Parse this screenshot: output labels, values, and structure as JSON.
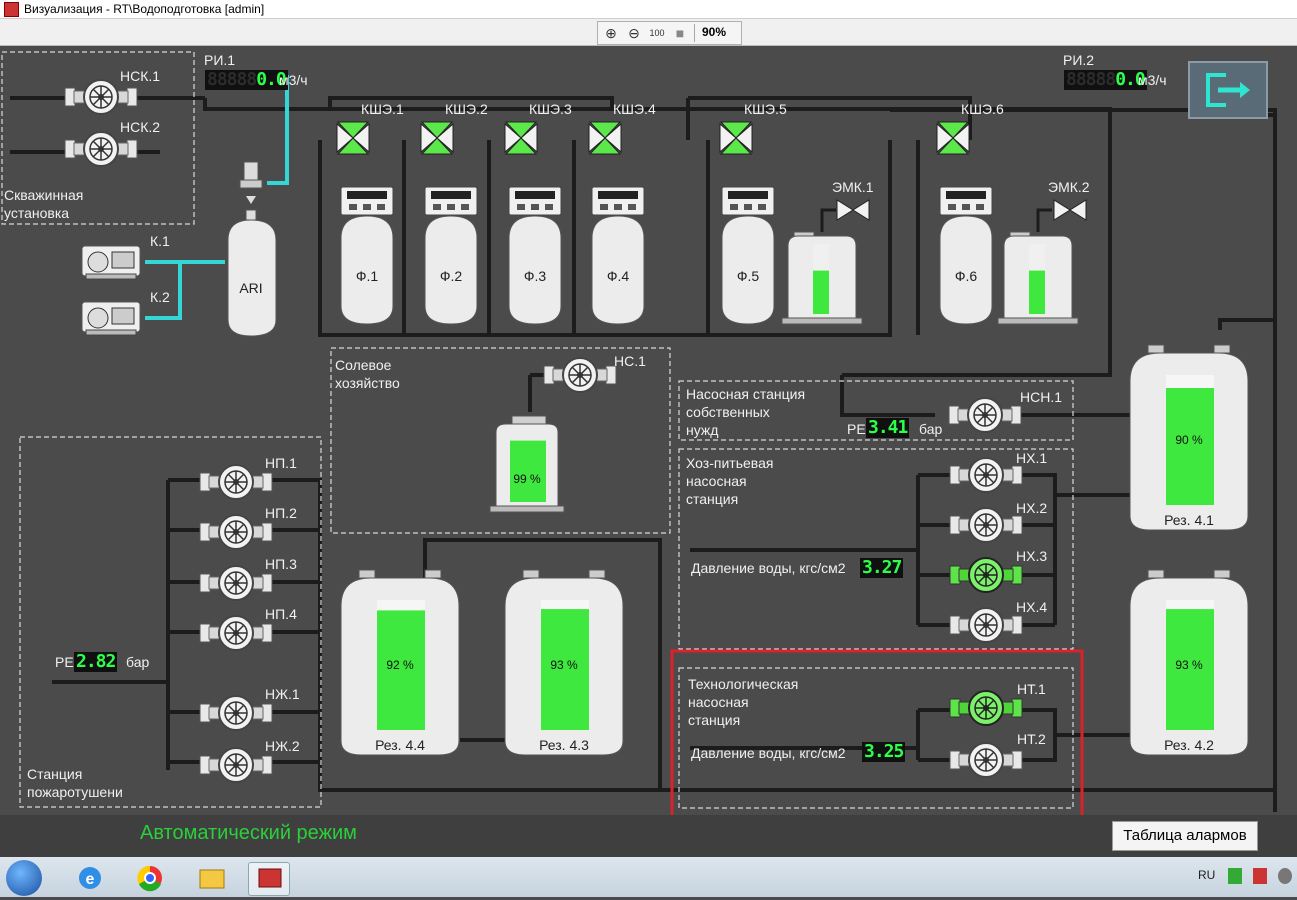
{
  "window": {
    "title": "Визуализация - RT\\Водоподготовка [admin]"
  },
  "toolbar": {
    "zoom_in": "zoom-in",
    "zoom_out": "zoom-out",
    "zoom_reset": "100",
    "zoom_level": "90%"
  },
  "flow_meters": {
    "ri1": {
      "label": "РИ.1",
      "ghost": "88888",
      "value": "0.0",
      "unit": "м3/ч"
    },
    "ri2": {
      "label": "РИ.2",
      "ghost": "88888",
      "value": "0.0",
      "unit": "м3/ч"
    }
  },
  "well": {
    "title_1": "Скважинная",
    "title_2": "установка",
    "pumps": [
      "НСК.1",
      "НСК.2"
    ]
  },
  "compressors": [
    "К.1",
    "К.2"
  ],
  "ari": "ARI",
  "valves": [
    "КШЭ.1",
    "КШЭ.2",
    "КШЭ.3",
    "КШЭ.4",
    "КШЭ.5",
    "КШЭ.6"
  ],
  "filters": [
    "Ф.1",
    "Ф.2",
    "Ф.3",
    "Ф.4",
    "Ф.5",
    "Ф.6"
  ],
  "emk": [
    {
      "label": "ЭМК.1",
      "level": 0.62
    },
    {
      "label": "ЭМК.2",
      "level": 0.62
    }
  ],
  "salt": {
    "title_1": "Солевое",
    "title_2": "хозяйство",
    "pump": "НС.1",
    "tank_level_text": "99 %",
    "tank_level": 0.99
  },
  "own_needs": {
    "title_1": "Насосная станция",
    "title_2": "собственных",
    "title_3": "нужд",
    "pe_label": "РЕ",
    "pe_value": "3.41",
    "unit": "бар",
    "pump": "НСН.1"
  },
  "household": {
    "title_1": "Хоз-питьевая",
    "title_2": "насосная",
    "title_3": "станция",
    "pressure_label": "Давление воды, кгс/см2",
    "pressure_value": "3.27",
    "pumps": [
      "НХ.1",
      "НХ.2",
      "НХ.3",
      "НХ.4"
    ]
  },
  "technological": {
    "title_1": "Технологическая",
    "title_2": "насосная",
    "title_3": "станция",
    "pressure_label": "Давление воды, кгс/см2",
    "pressure_value": "3.25",
    "pumps": [
      "НТ.1",
      "НТ.2"
    ]
  },
  "fire": {
    "title_1": "Станция",
    "title_2": "пожаротушени",
    "pe_label": "РЕ",
    "pe_value": "2.82",
    "unit": "бар",
    "pumps": [
      "НП.1",
      "НП.2",
      "НП.3",
      "НП.4",
      "НЖ.1",
      "НЖ.2"
    ]
  },
  "reservoirs": [
    {
      "name": "Рез. 4.1",
      "level_text": "90 %",
      "level": 0.9
    },
    {
      "name": "Рез. 4.2",
      "level_text": "93 %",
      "level": 0.93
    },
    {
      "name": "Рез. 4.3",
      "level_text": "93 %",
      "level": 0.93
    },
    {
      "name": "Рез. 4.4",
      "level_text": "92 %",
      "level": 0.92
    }
  ],
  "status": {
    "mode": "Автоматический режим",
    "alarm_button": "Таблица алармов"
  },
  "taskbar": {
    "lang": "RU"
  },
  "colors": {
    "background": "#4b4b4b",
    "pipe": "#1e1e1e",
    "water_line": "#35d6d6",
    "active": "#3ee83e",
    "highlight": "#d9222a"
  }
}
